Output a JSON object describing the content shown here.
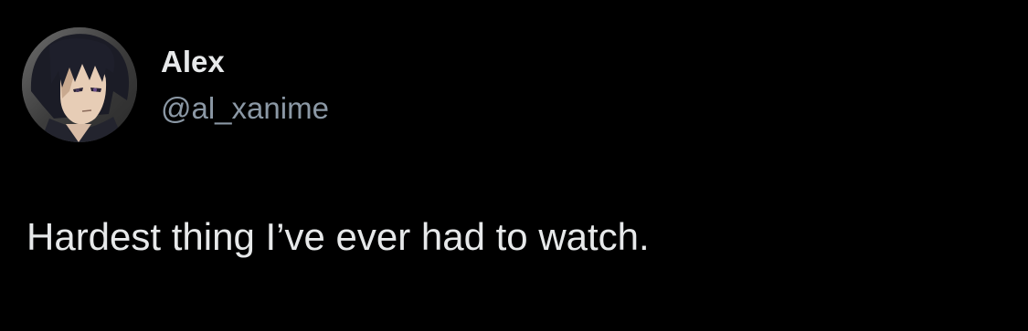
{
  "tweet": {
    "author": {
      "display_name": "Alex",
      "handle": "@al_xanime",
      "avatar_icon": "anime-character-avatar"
    },
    "text": "Hardest thing I’ve ever had to watch."
  },
  "colors": {
    "background": "#000000",
    "primary_text": "#e7e9ea",
    "secondary_text": "#8b98a5"
  }
}
